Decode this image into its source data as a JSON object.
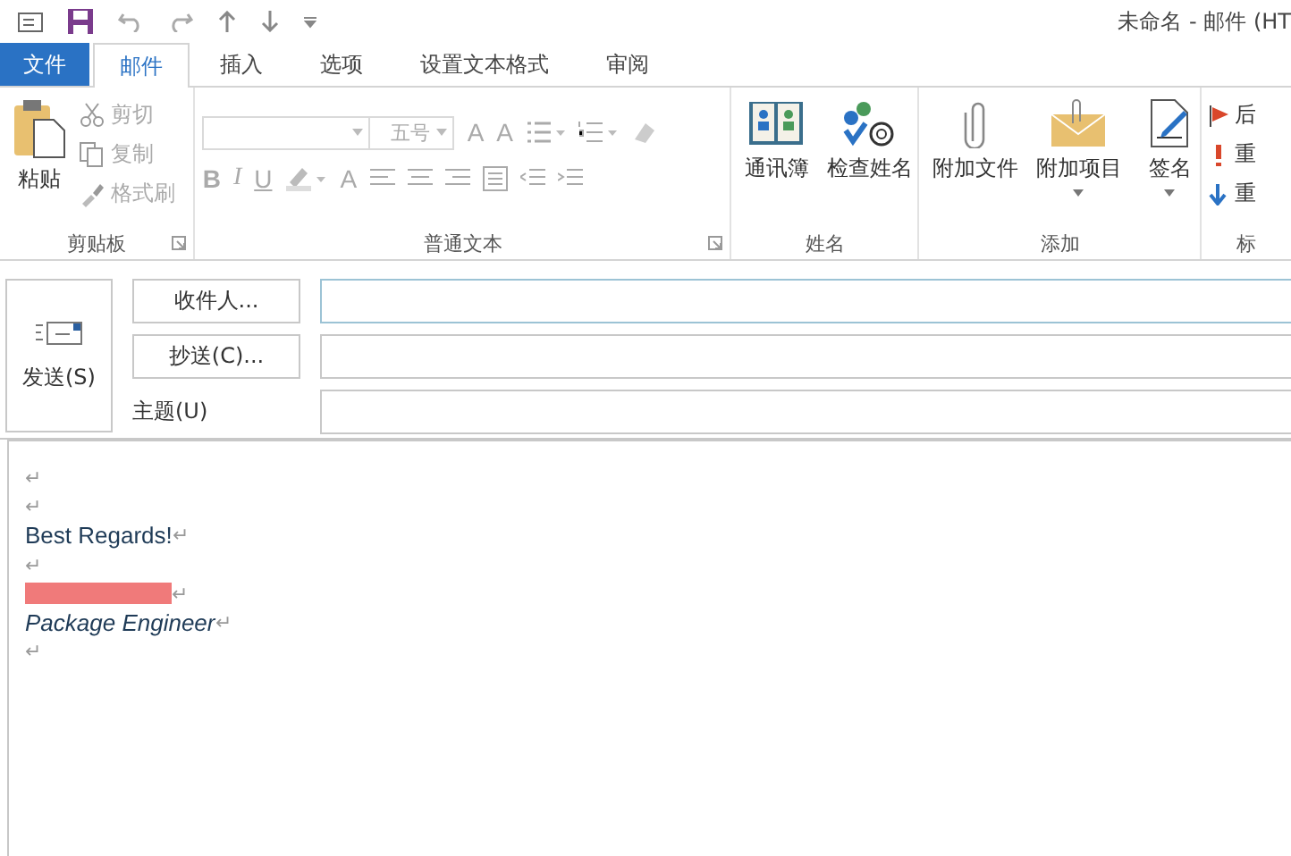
{
  "window": {
    "title": "未命名 - 邮件 (HT"
  },
  "tabs": [
    {
      "label": "文件",
      "kind": "file",
      "selected": false
    },
    {
      "label": "邮件",
      "kind": "tab",
      "selected": true
    },
    {
      "label": "插入",
      "kind": "tab",
      "selected": false
    },
    {
      "label": "选项",
      "kind": "tab",
      "selected": false
    },
    {
      "label": "设置文本格式",
      "kind": "tab",
      "selected": false
    },
    {
      "label": "审阅",
      "kind": "tab",
      "selected": false
    }
  ],
  "ribbon": {
    "clipboard": {
      "label": "剪贴板",
      "paste": "粘贴",
      "items": [
        {
          "label": "剪切",
          "disabled": true
        },
        {
          "label": "复制",
          "disabled": true
        },
        {
          "label": "格式刷",
          "disabled": true
        }
      ]
    },
    "basic_text": {
      "label": "普通文本",
      "font_size": "五号",
      "grow_font": "A",
      "shrink_font": "A",
      "format_buttons": [
        "B",
        "I",
        "U"
      ],
      "font_color": "A",
      "disabled": true
    },
    "names": {
      "label": "姓名",
      "buttons": [
        {
          "label": "通讯簿",
          "kind": "book"
        },
        {
          "label": "检查姓名",
          "kind": "check"
        }
      ]
    },
    "include": {
      "label": "添加",
      "buttons": [
        {
          "label": "附加文件",
          "kind": "clip",
          "dropdown": false
        },
        {
          "label": "附加项目",
          "kind": "envelope",
          "dropdown": true
        },
        {
          "label": "签名",
          "kind": "sign",
          "dropdown": true
        }
      ]
    },
    "tags": {
      "label": "标",
      "items": [
        {
          "label": "后",
          "kind": "flag"
        },
        {
          "label": "重",
          "kind": "high"
        },
        {
          "label": "重",
          "kind": "low"
        }
      ]
    }
  },
  "header": {
    "send": "发送(S)",
    "fields": [
      {
        "label": "收件人...",
        "kind": "button",
        "focused": true
      },
      {
        "label": "抄送(C)...",
        "kind": "button",
        "focused": false
      },
      {
        "label": "主题(U)",
        "kind": "label",
        "focused": false
      }
    ]
  },
  "body": [
    {
      "kind": "text",
      "mark": "↵"
    },
    {
      "kind": "text",
      "mark": "↵"
    },
    {
      "kind": "text",
      "text": "Best Regards!",
      "mark": "↵"
    },
    {
      "kind": "text",
      "mark": "↵"
    },
    {
      "kind": "redacted",
      "mark": "↵"
    },
    {
      "kind": "text",
      "text": "Package Engineer",
      "italic": true,
      "mark": "↵"
    },
    {
      "kind": "text",
      "mark": "↵"
    }
  ]
}
